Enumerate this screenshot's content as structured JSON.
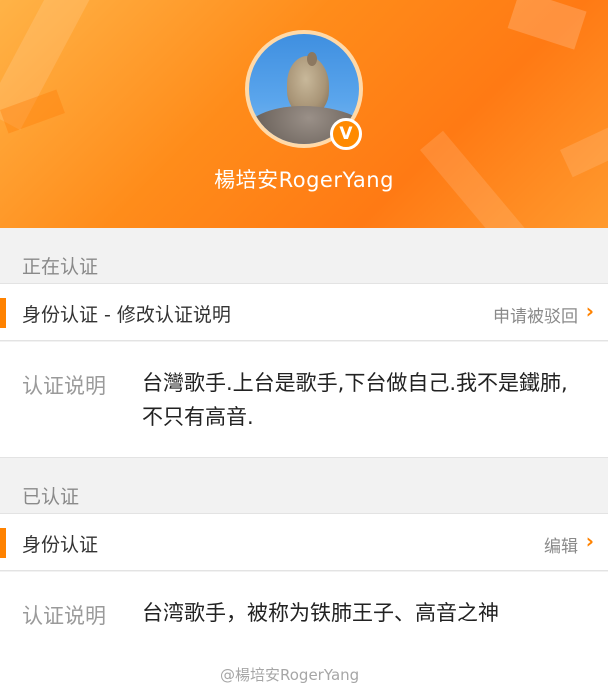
{
  "profile": {
    "username": "楊培安RogerYang",
    "verified_badge": "V",
    "accent_color": "#ff8200"
  },
  "pending": {
    "section_title": "正在认证",
    "row_label": "身份认证 - 修改认证说明",
    "row_action": "申请被驳回",
    "desc_key": "认证说明",
    "desc_value": "台灣歌手.上台是歌手,下台做自己.我不是鐵肺,不只有高音."
  },
  "verified": {
    "section_title": "已认证",
    "row_label": "身份认证",
    "row_action": "编辑",
    "desc_key": "认证说明",
    "desc_value": "台湾歌手，被称为铁肺王子、高音之神"
  },
  "watermark": "@楊培安RogerYang",
  "icons": {
    "chevron": "chevron-right-icon",
    "verified": "verified-badge-icon"
  }
}
